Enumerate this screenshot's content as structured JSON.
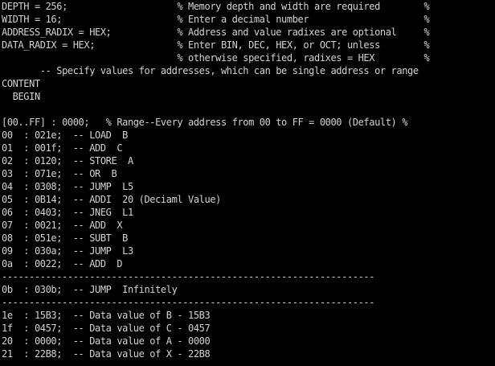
{
  "colors": {
    "background": "#000000",
    "text": "#d2d2d2"
  },
  "header": [
    "DEPTH = 256;                    % Memory depth and width are required        %",
    "WIDTH = 16;                     % Enter a decimal number                     %",
    "ADDRESS_RADIX = HEX;            % Address and value radixes are optional     %",
    "DATA_RADIX = HEX;               % Enter BIN, DEC, HEX, or OCT; unless        %",
    "                                % otherwise specified, radixes = HEX         %",
    "       -- Specify values for addresses, which can be single address or range",
    "CONTENT",
    "  BEGIN"
  ],
  "range_line": "[00..FF] : 0000;   % Range--Every address from 00 to FF = 0000 (Default) %",
  "instructions": [
    "00  : 021e;  -- LOAD  B",
    "01  : 001f;  -- ADD  C",
    "02  : 0120;  -- STORE  A",
    "03  : 071e;  -- OR  B",
    "04  : 0308;  -- JUMP  L5",
    "05  : 0B14;  -- ADDI  20 (Deciaml Value)",
    "06  : 0403;  -- JNEG  L1",
    "07  : 0021;  -- ADD  X",
    "08  : 051e;  -- SUBT  B",
    "09  : 030a;  -- JUMP  L3",
    "0a  : 0022;  -- ADD  D"
  ],
  "separator_1": "--------------------------------------------------------------------",
  "jump_line": "0b  : 030b;  -- JUMP  Infinitely",
  "separator_2": "--------------------------------------------------------------------",
  "data_values": [
    "1e  : 15B3;  -- Data value of B - 15B3",
    "1f  : 0457;  -- Data value of C - 0457",
    "20  : 0000;  -- Data value of A - 0000",
    "21  : 22B8;  -- Data value of X - 22B8"
  ]
}
